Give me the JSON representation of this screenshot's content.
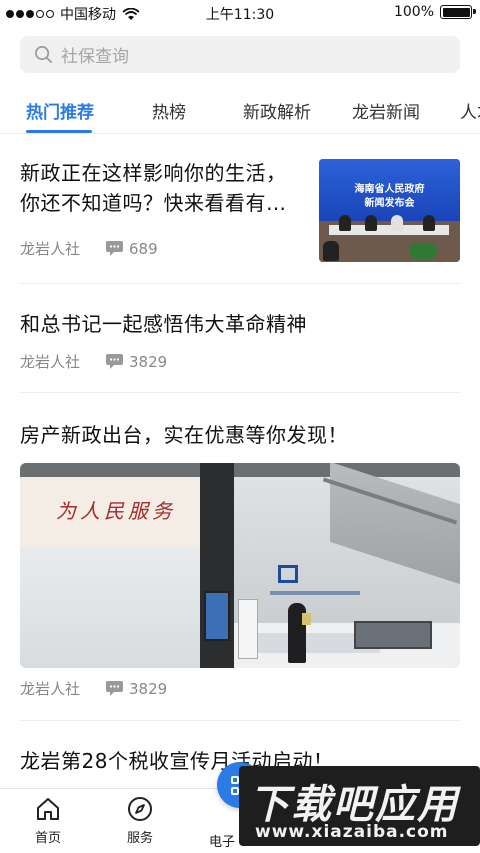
{
  "status_bar": {
    "carrier": "中国移动",
    "time": "上午11:30",
    "battery": "100%"
  },
  "search": {
    "placeholder": "社保查询"
  },
  "tabs": [
    {
      "label": "热门推荐",
      "active": true
    },
    {
      "label": "热榜"
    },
    {
      "label": "新政解析"
    },
    {
      "label": "龙岩新闻"
    },
    {
      "label": "人才"
    }
  ],
  "articles": [
    {
      "title_line1": "新政正在这样影响你的生活，",
      "title_line2": "你还不知道吗？快来看看有…",
      "source": "龙岩人社",
      "comments": "689",
      "thumbnail_text_line1": "海南省人民政府",
      "thumbnail_text_line2": "新闻发布会"
    },
    {
      "title": "和总书记一起感悟伟大革命精神",
      "source": "龙岩人社",
      "comments": "3829"
    },
    {
      "title": "房产新政出台，实在优惠等你发现！",
      "source": "龙岩人社",
      "comments": "3829"
    },
    {
      "title": "龙岩第28个税收宣传月活动启动！"
    }
  ],
  "bottom_nav": [
    {
      "label": "首页",
      "icon": "home-icon"
    },
    {
      "label": "服务",
      "icon": "compass-icon"
    },
    {
      "label": "电子",
      "icon": "card-icon"
    }
  ],
  "watermark": {
    "title": "下载吧应用",
    "url": "www.xiazaiba.com"
  },
  "colors": {
    "accent": "#2b7be6",
    "text": "#111111",
    "meta": "#888888"
  }
}
